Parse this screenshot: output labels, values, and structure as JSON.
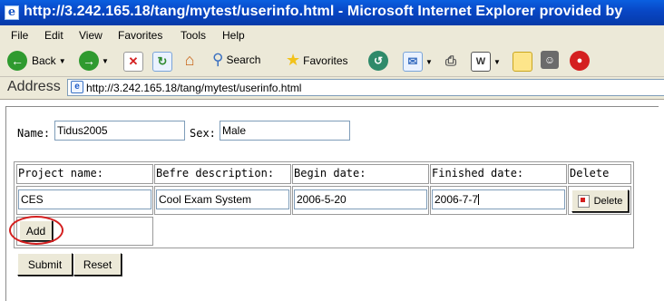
{
  "window": {
    "title": "http://3.242.165.18/tang/mytest/userinfo.html - Microsoft Internet Explorer provided by"
  },
  "menu": [
    "File",
    "Edit",
    "View",
    "Favorites",
    "Tools",
    "Help"
  ],
  "toolbar": {
    "back_label": "Back",
    "search_label": "Search",
    "favorites_label": "Favorites"
  },
  "address": {
    "label": "Address",
    "url": "http://3.242.165.18/tang/mytest/userinfo.html"
  },
  "form": {
    "name_label": "Name:",
    "name_value": "Tidus2005",
    "sex_label": "Sex:",
    "sex_value": "Male",
    "headers": [
      "Project name:",
      "Befre description:",
      "Begin date:",
      "Finished date:",
      "Delete"
    ],
    "rows": [
      {
        "project": "CES",
        "description": "Cool Exam System",
        "begin": "2006-5-20",
        "finished": "2006-7-7",
        "delete_label": "Delete"
      }
    ],
    "add_label": "Add",
    "submit_label": "Submit",
    "reset_label": "Reset"
  },
  "colors": {
    "titlebar": "#0846c4",
    "chrome": "#ece9d8",
    "highlight_circle": "#d42020"
  }
}
